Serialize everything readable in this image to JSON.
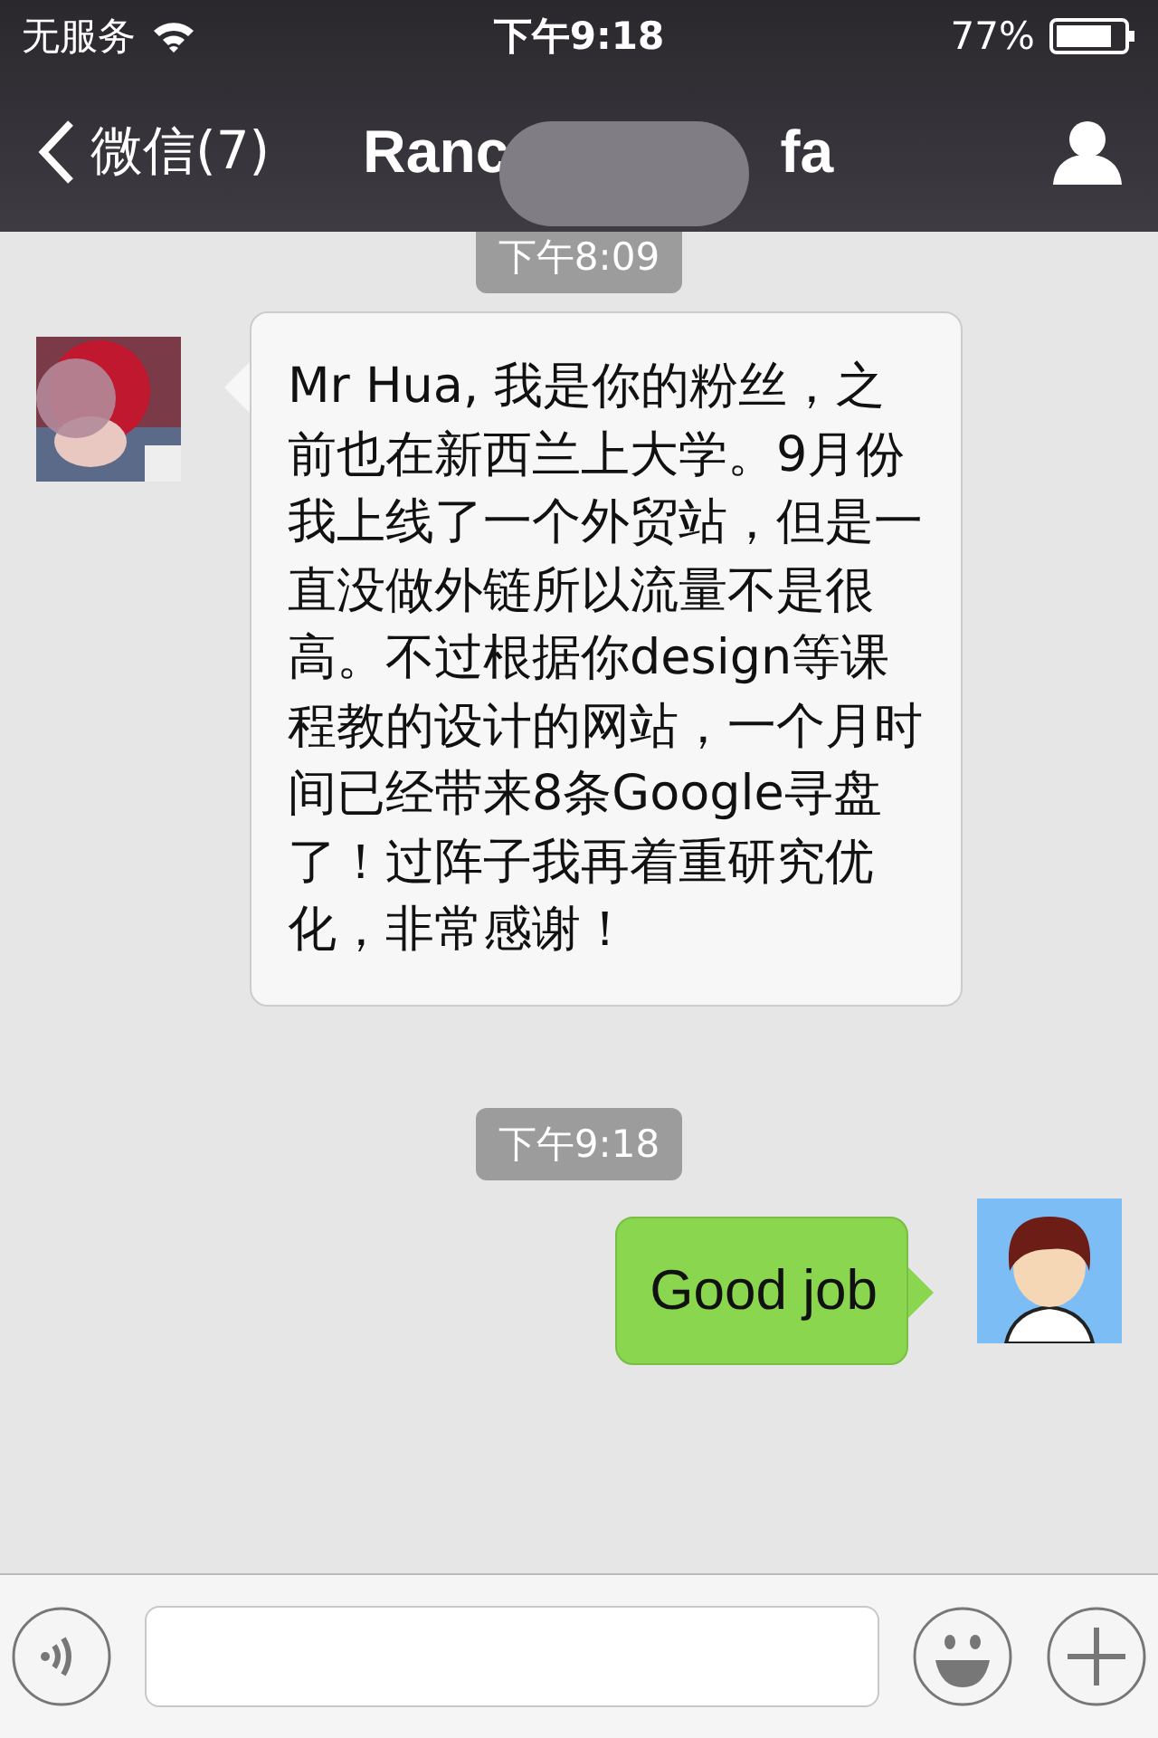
{
  "status_bar": {
    "carrier": "无服务",
    "time": "下午9:18",
    "battery": "77%"
  },
  "nav": {
    "back": "微信(7)",
    "title_start": "Ranc",
    "title_end": "fa"
  },
  "chat": [
    {
      "kind": "time",
      "text": "下午8:09"
    },
    {
      "kind": "received",
      "text": "Mr Hua, 我是你的粉丝，之前也在新西兰上大学。9月份我上线了一个外贸站，但是一直没做外链所以流量不是很高。不过根据你design等课程教的设计的网站，一个月时间已经带来8条Google寻盘了！过阵子我再着重研究优化，非常感谢！"
    },
    {
      "kind": "time",
      "text": "下午9:18"
    },
    {
      "kind": "sent",
      "text": "Good job"
    }
  ]
}
